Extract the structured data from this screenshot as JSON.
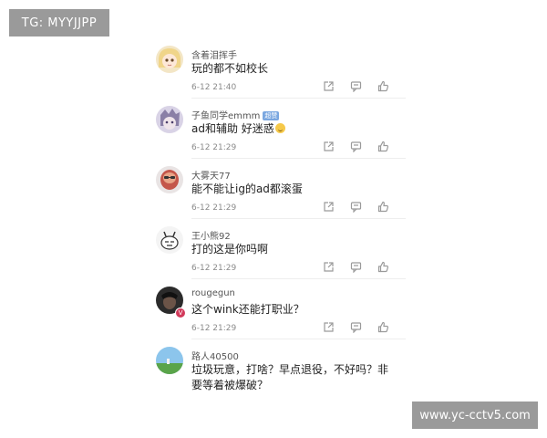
{
  "watermarks": {
    "top": "TG: MYYJJPP",
    "bottom": "www.yc-cctv5.com"
  },
  "comments": [
    {
      "user": "含着泪挥手",
      "text": "玩的都不如校长",
      "time": "6-12 21:40",
      "avatar_icon": "anime-girl-avatar"
    },
    {
      "user": "子鱼同学emmm",
      "tag": "超赞",
      "text": "ad和辅助 好迷惑",
      "emoji": "smile-emoji",
      "time": "6-12 21:29",
      "avatar_icon": "anime-character-avatar"
    },
    {
      "user": "大雾天77",
      "text": "能不能让ig的ad都滚蛋",
      "time": "6-12 21:29",
      "avatar_icon": "bearded-man-avatar"
    },
    {
      "user": "王小熊92",
      "text": "打的这是你吗啊",
      "time": "6-12 21:29",
      "avatar_icon": "cartoon-doodle-avatar"
    },
    {
      "user": "rougegun",
      "text": "这个wink还能打职业？",
      "time": "6-12 21:29",
      "avatar_icon": "dark-portrait-avatar",
      "verified": true
    },
    {
      "user": "路人40500",
      "text": "垃圾玩意，打啥？早点退役，不好吗？非要等着被爆破？",
      "time": "6-12 21:29",
      "avatar_icon": "landscape-avatar"
    }
  ],
  "action_icons": [
    "share-icon",
    "reply-icon",
    "like-icon"
  ],
  "colors": {
    "watermark_bg": "#9a9a9a",
    "text": "#222222",
    "meta": "#8a8a8a",
    "icon": "#9a9a9a",
    "verified_badge": "#d23a5b"
  }
}
